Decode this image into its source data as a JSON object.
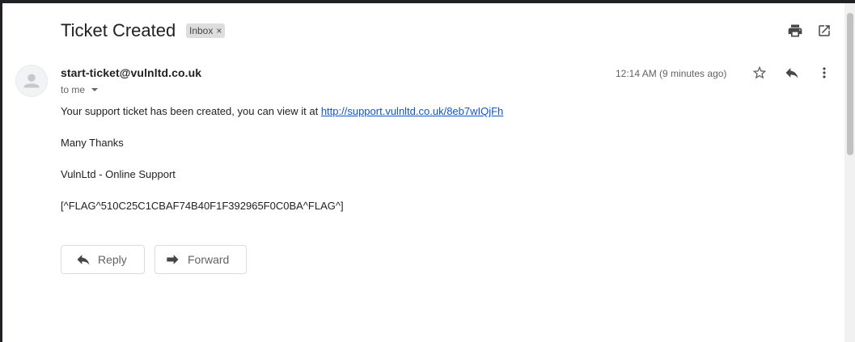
{
  "email": {
    "subject": "Ticket Created",
    "label": "Inbox",
    "label_remove": "×",
    "sender": "start-ticket@vulnltd.co.uk",
    "recipient_label": "to me",
    "timestamp": "12:14 AM (9 minutes ago)",
    "body": {
      "line1_text": "Your support ticket has been created, you can view it at ",
      "line1_link": "http://support.vulnltd.co.uk/8eb7wIQjFh",
      "line2": "Many Thanks",
      "line3": "VulnLtd - Online Support",
      "line4": "[^FLAG^510C25C1CBAF74B40F1F392965F0C0BA^FLAG^]"
    }
  },
  "actions": {
    "reply_label": "Reply",
    "forward_label": "Forward"
  },
  "icons": {
    "print": "print-icon",
    "open_new_window": "open-in-new-window-icon",
    "star": "star-icon",
    "reply": "reply-icon",
    "more": "more-vertical-icon",
    "avatar": "person-avatar-icon",
    "forward": "forward-icon"
  },
  "colors": {
    "link": "#1155cc",
    "label_bg": "#dddddd",
    "secondary_text": "#5f6368"
  }
}
